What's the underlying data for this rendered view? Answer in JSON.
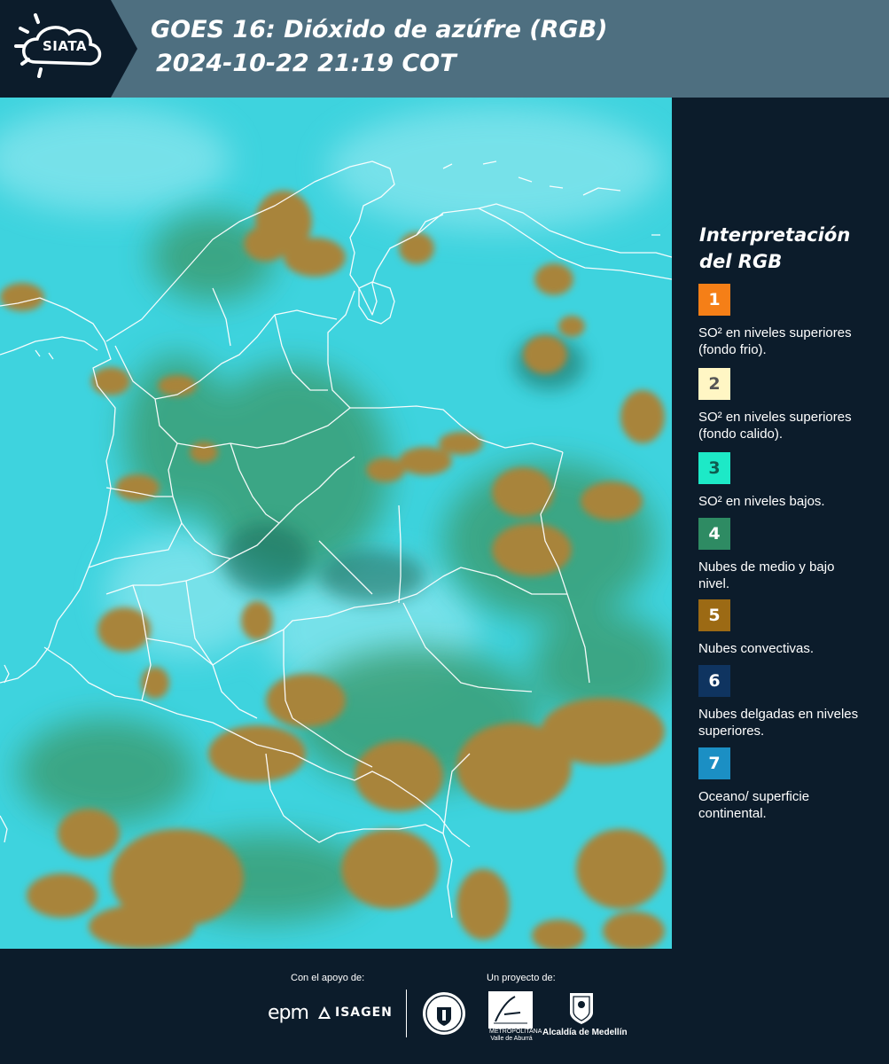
{
  "header": {
    "title_line1": "GOES 16: Dióxido de azúfre (RGB)",
    "title_line2": "2024-10-22 21:19 COT",
    "logo_text": "SIATA"
  },
  "legend": {
    "title_line1": "Interpretación",
    "title_line2": "del RGB",
    "items": [
      {
        "number": "1",
        "color": "#f57f17",
        "text_color": "#ffffff",
        "label": "SO² en niveles superiores (fondo frio)."
      },
      {
        "number": "2",
        "color": "#fff6c4",
        "text_color": "#555555",
        "label": "SO² en niveles superiores (fondo calido)."
      },
      {
        "number": "3",
        "color": "#1de9c7",
        "text_color": "#0e5c4f",
        "label": "SO² en niveles bajos."
      },
      {
        "number": "4",
        "color": "#2e8b63",
        "text_color": "#ffffff",
        "label": "Nubes de medio y bajo nivel."
      },
      {
        "number": "5",
        "color": "#9c6a14",
        "text_color": "#ffffff",
        "label": "Nubes convectivas."
      },
      {
        "number": "6",
        "color": "#0f3460",
        "text_color": "#ffffff",
        "label": "Nubes delgadas en niveles superiores."
      },
      {
        "number": "7",
        "color": "#1b8fc4",
        "text_color": "#ffffff",
        "label": "Oceano/ superficie continental."
      }
    ]
  },
  "footer": {
    "support_label": "Con el apoyo de:",
    "project_label": "Un proyecto de:",
    "sponsor1": "epm",
    "sponsor2": "ISAGEN",
    "partner_metro": "METROPOLITANA Valle de Aburrá",
    "partner_alcaldia": "Alcaldía de Medellín"
  },
  "map": {
    "background_color": "#3ad2de",
    "cloud_color": "#a5822e",
    "border_color": "#ffffff"
  }
}
